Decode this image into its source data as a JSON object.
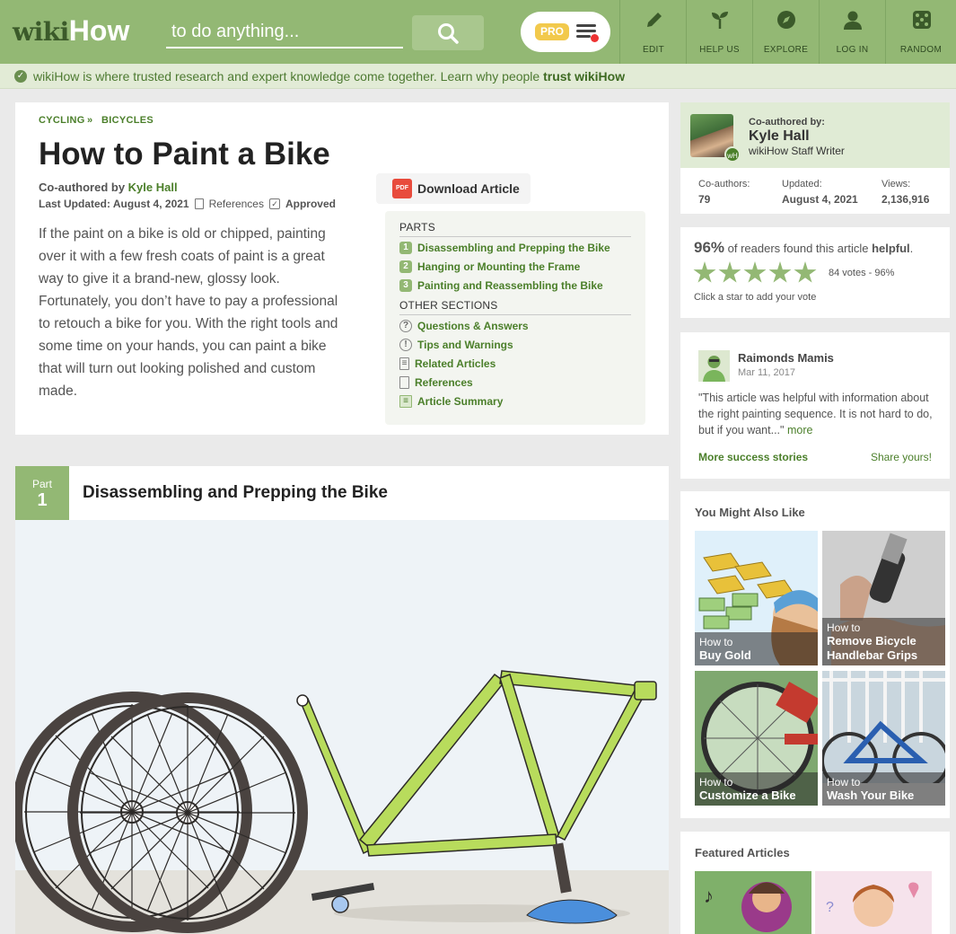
{
  "header": {
    "logo_part1": "wiki",
    "logo_part2": "How",
    "search_placeholder": "to do anything...",
    "pro_badge": "PRO",
    "nav": [
      {
        "label": "EDIT",
        "icon": "pencil-icon"
      },
      {
        "label": "HELP US",
        "icon": "sprout-icon"
      },
      {
        "label": "EXPLORE",
        "icon": "compass-icon"
      },
      {
        "label": "LOG IN",
        "icon": "user-icon"
      },
      {
        "label": "RANDOM",
        "icon": "dice-icon"
      }
    ]
  },
  "trust_bar": {
    "text": "wikiHow is where trusted research and expert knowledge come together. Learn why people ",
    "link": "trust wikiHow"
  },
  "article": {
    "breadcrumbs": [
      "CYCLING",
      "BICYCLES"
    ],
    "breadcrumb_sep": "»",
    "title": "How to Paint a Bike",
    "coauthor_prefix": "Co-authored by ",
    "coauthor_name": "Kyle Hall",
    "last_updated": "Last Updated: August 4, 2021",
    "references_label": "References",
    "approved_label": "Approved",
    "intro": "If the paint on a bike is old or chipped, painting over it with a few fresh coats of paint is a great way to give it a brand-new, glossy look. Fortunately, you don’t have to pay a professional to retouch a bike for you. With the right tools and some time on your hands, you can paint a bike that will turn out looking polished and custom made.",
    "download_label": "Download Article",
    "pdf_icon_text": "PDF"
  },
  "toc": {
    "parts_heading": "PARTS",
    "parts": [
      {
        "num": "1",
        "label": "Disassembling and Prepping the Bike"
      },
      {
        "num": "2",
        "label": "Hanging or Mounting the Frame"
      },
      {
        "num": "3",
        "label": "Painting and Reassembling the Bike"
      }
    ],
    "other_heading": "OTHER SECTIONS",
    "other": [
      {
        "label": "Questions & Answers",
        "icon": "question-icon",
        "glyph": "?"
      },
      {
        "label": "Tips and Warnings",
        "icon": "exclamation-icon",
        "glyph": "!"
      },
      {
        "label": "Related Articles",
        "icon": "document-icon",
        "glyph": "≡"
      },
      {
        "label": "References",
        "icon": "page-icon",
        "glyph": ""
      },
      {
        "label": "Article Summary",
        "icon": "summary-icon",
        "glyph": "≡"
      }
    ]
  },
  "part": {
    "word": "Part",
    "number": "1",
    "title": "Disassembling and Prepping the Bike"
  },
  "author_card": {
    "coauthored_label": "Co-authored by:",
    "name": "Kyle Hall",
    "role": "wikiHow Staff Writer",
    "badge": "wH",
    "stats": [
      {
        "label": "Co-authors:",
        "value": "79"
      },
      {
        "label": "Updated:",
        "value": "August 4, 2021"
      },
      {
        "label": "Views:",
        "value": "2,136,916"
      }
    ]
  },
  "rating": {
    "percent": "96%",
    "text_mid": " of readers found this article ",
    "text_hl": "helpful",
    "text_end": ".",
    "stars_filled": 5,
    "votes": "84 votes - 96%",
    "hint": "Click a star to add your vote"
  },
  "success": {
    "reviewer": "Raimonds Mamis",
    "date": "Mar 11, 2017",
    "quote": "\"This article was helpful with information about the right painting sequence. It is not hard to do, but if you want...\"",
    "more_link": "more",
    "more_stories": "More success stories",
    "share": "Share yours!"
  },
  "related": {
    "heading": "You Might Also Like",
    "howto": "How to",
    "items": [
      {
        "title": "Buy Gold"
      },
      {
        "title": "Remove Bicycle Handlebar Grips"
      },
      {
        "title": "Customize a Bike"
      },
      {
        "title": "Wash Your Bike"
      }
    ]
  },
  "featured": {
    "heading": "Featured Articles"
  },
  "colors": {
    "brand_green": "#93b874",
    "link_green": "#4b7f2a",
    "pro_yellow": "#f2c94c",
    "frame_green": "#b8dc5c"
  }
}
